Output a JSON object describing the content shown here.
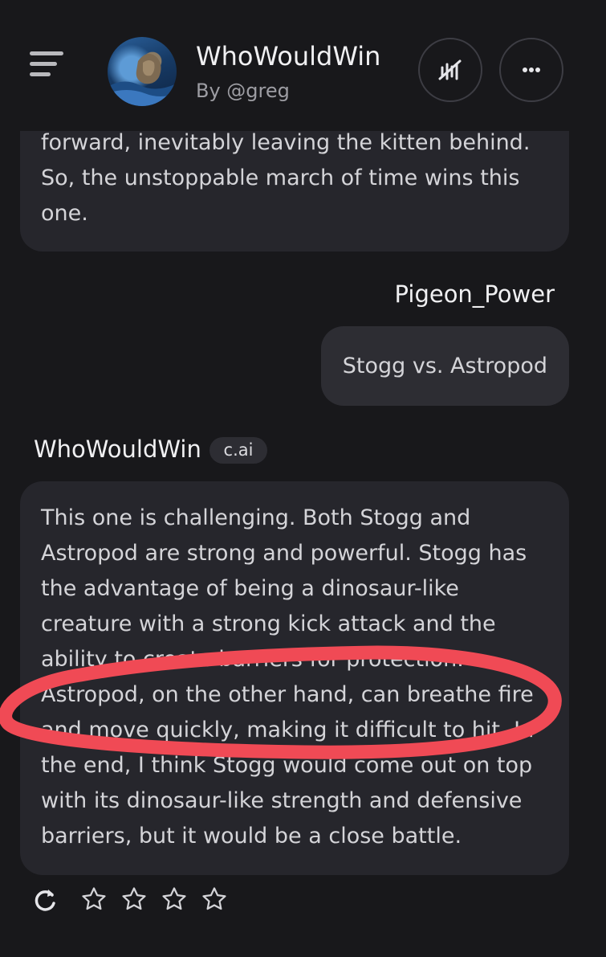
{
  "header": {
    "bot_name": "WhoWouldWin",
    "byline": "By @greg",
    "icons": [
      "menu-icon",
      "voice-call-icon",
      "more-icon"
    ]
  },
  "messages": {
    "previous": {
      "lines": [
        "forward, inevitably leaving the kitten behind.",
        "So, the unstoppable march of time wins this",
        "one."
      ]
    },
    "user": {
      "name": "Pigeon_Power",
      "text": "Stogg vs. Astropod"
    },
    "bot": {
      "name": "WhoWouldWin",
      "badge": "c.ai",
      "lines": [
        "This one is challenging. Both Stogg and",
        "Astropod are strong and powerful. Stogg has",
        "the advantage of being a dinosaur-like",
        "creature with a strong kick attack and the",
        "ability to create barriers for protection.",
        "Astropod, on the other hand, can breathe fire",
        "and move quickly, making it difficult to hit. In",
        "the end, I think Stogg would come out on top",
        "with its dinosaur-like strength and defensive",
        "barriers, but it would be a close battle."
      ]
    }
  },
  "actions": {
    "icons": [
      "regenerate-icon",
      "star-icon",
      "star-icon",
      "star-icon",
      "star-icon"
    ],
    "rating_max": 4,
    "rating_value": 0
  },
  "colors": {
    "background": "#18181b",
    "bubble": "#26262c",
    "user_bubble": "#2d2d33",
    "annotation": "#f04a55"
  }
}
